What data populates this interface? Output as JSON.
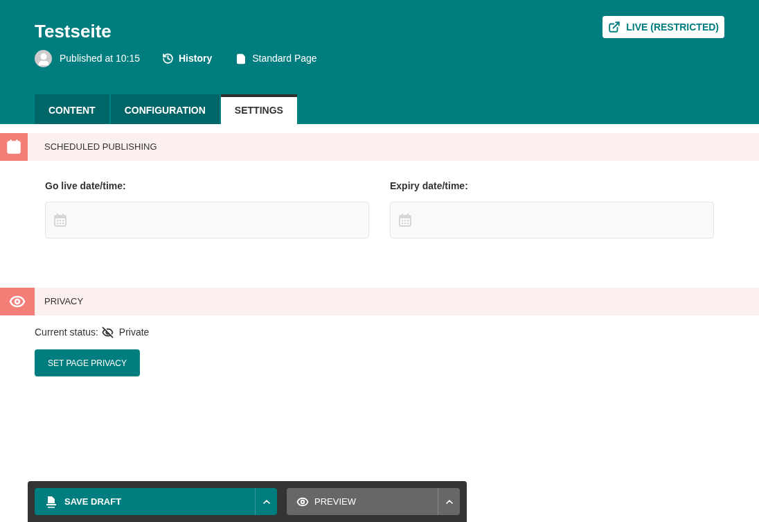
{
  "header": {
    "title": "Testseite",
    "status": "Published at 10:15",
    "history": "History",
    "page_type": "Standard Page",
    "live_button": "LIVE (RESTRICTED)"
  },
  "tabs": [
    {
      "label": "CONTENT",
      "selected": false
    },
    {
      "label": "CONFIGURATION",
      "selected": false
    },
    {
      "label": "SETTINGS",
      "selected": true
    }
  ],
  "scheduled_publishing": {
    "title": "SCHEDULED PUBLISHING",
    "fields": [
      {
        "label": "Go live date/time:"
      },
      {
        "label": "Expiry date/time:"
      }
    ]
  },
  "privacy": {
    "title": "PRIVACY",
    "status_label": "Current status:",
    "status": "Private",
    "button": "SET PAGE PRIVACY"
  },
  "footer": {
    "save": "SAVE DRAFT",
    "preview": "PREVIEW"
  }
}
